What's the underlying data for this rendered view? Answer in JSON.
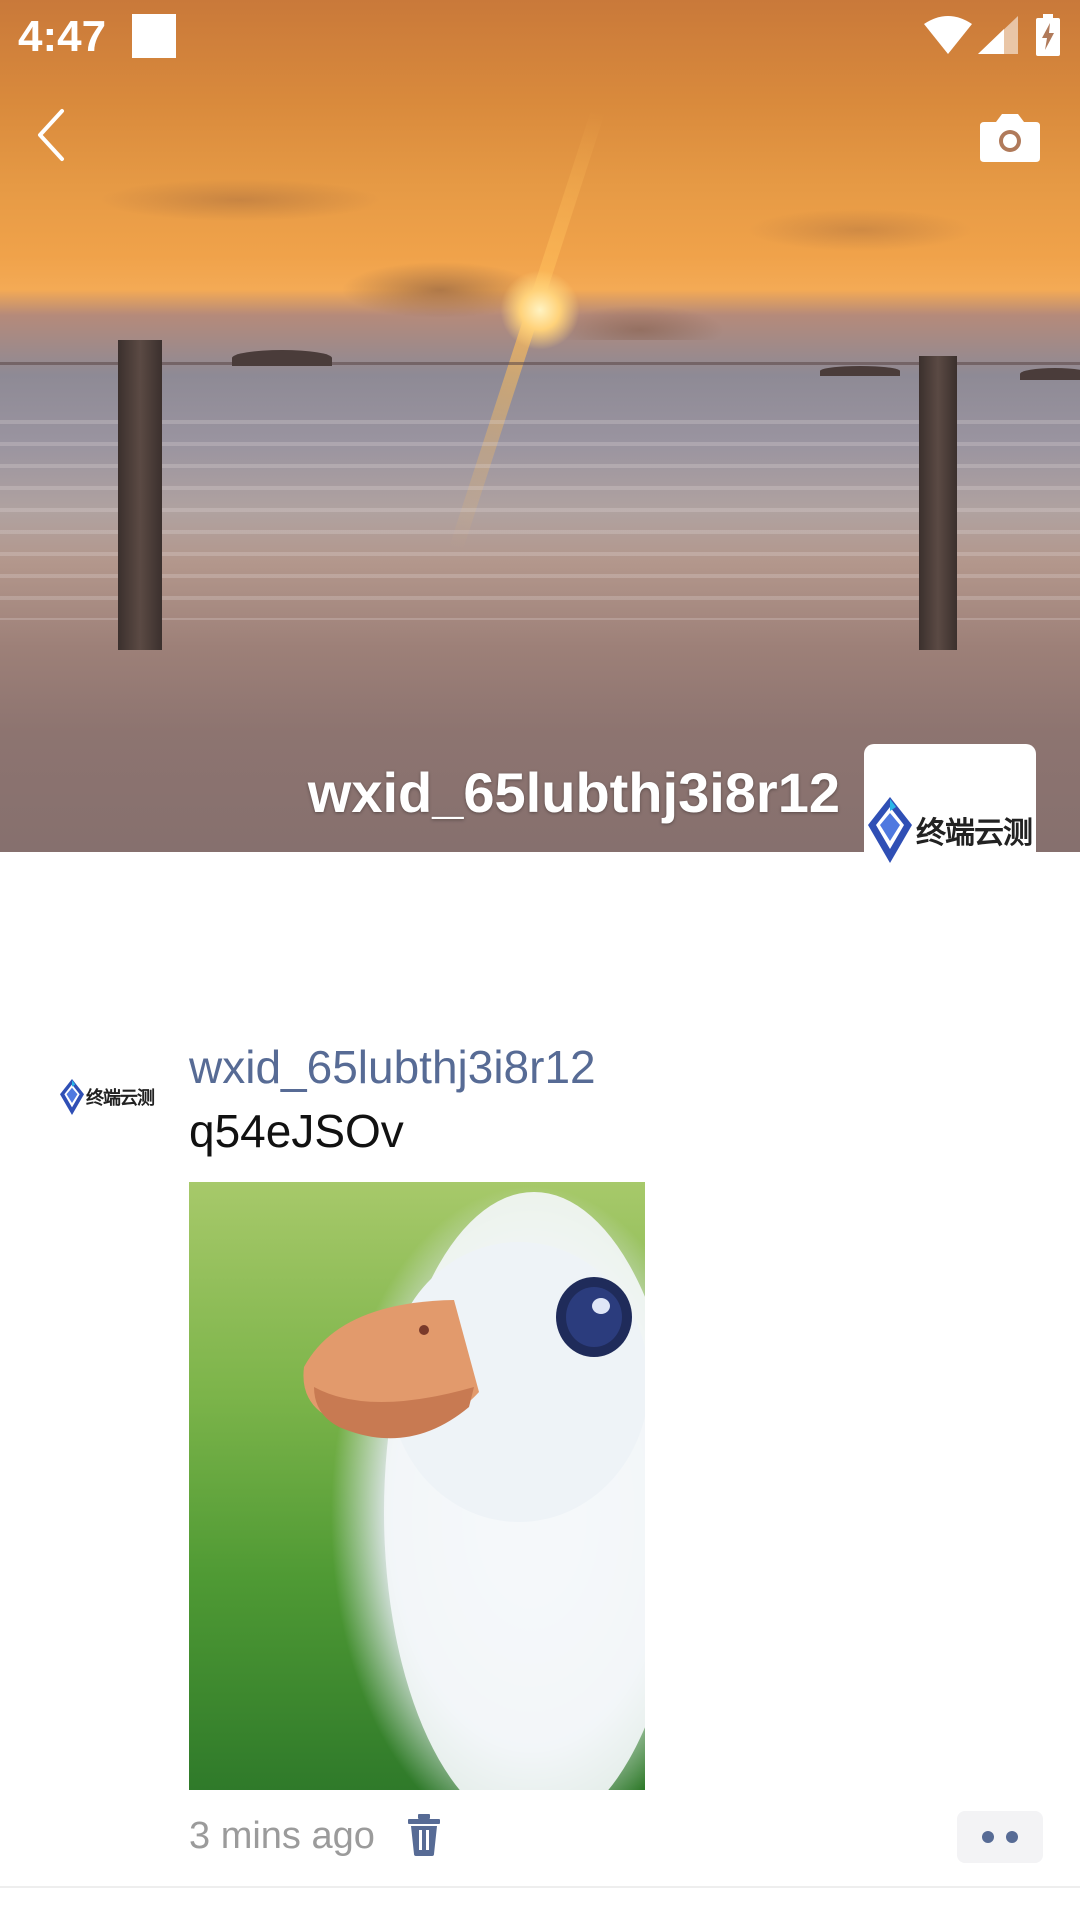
{
  "status_bar": {
    "time": "4:47"
  },
  "cover": {
    "username": "wxid_65lubthj3i8r12"
  },
  "logo": {
    "text": "终端云测"
  },
  "post": {
    "author": "wxid_65lubthj3i8r12",
    "text": "q54eJSOv",
    "timestamp": "3 mins ago"
  },
  "colors": {
    "link_blue": "#576b95",
    "time_gray": "#9b9b9b",
    "logo_blue": "#2f4fb5"
  },
  "icons": {
    "back": "back-chevron-icon",
    "camera": "camera-icon",
    "delete": "trash-icon",
    "more": "more-dots-icon",
    "wifi": "wifi-icon",
    "signal": "signal-icon",
    "battery": "battery-charging-icon"
  }
}
